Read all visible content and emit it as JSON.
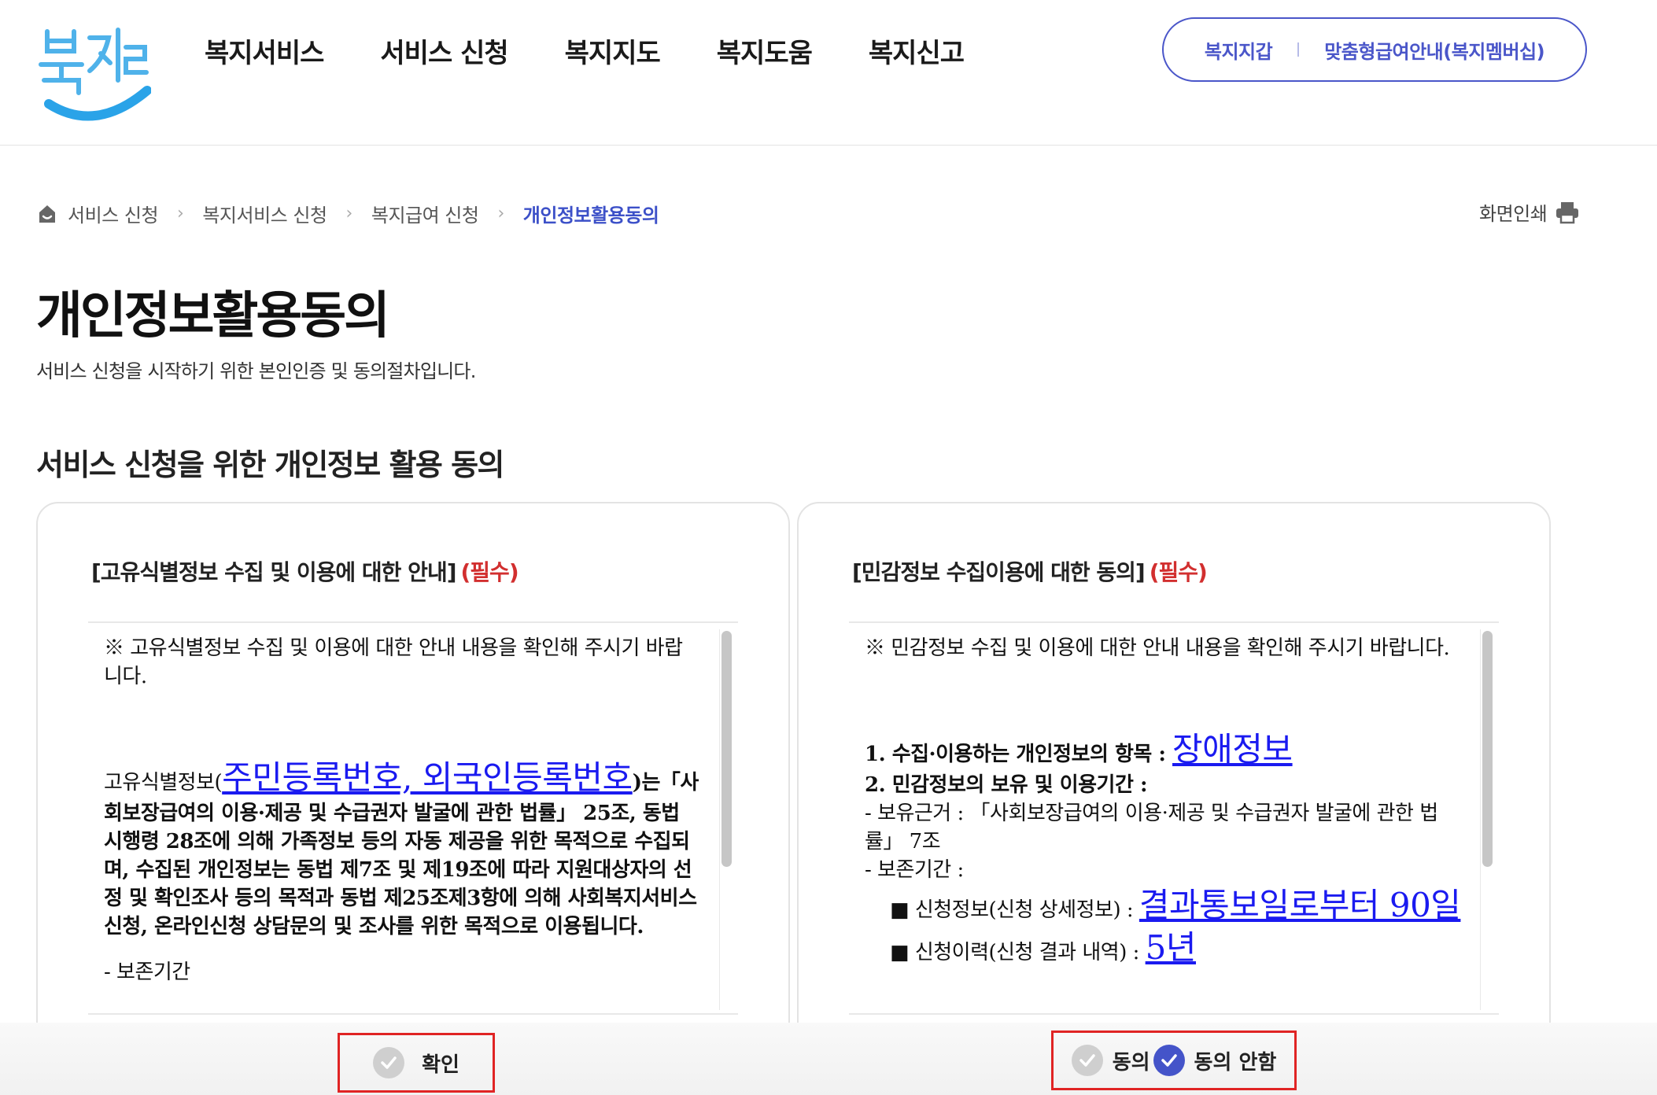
{
  "header": {
    "logo_text": "복지로",
    "nav": [
      "복지서비스",
      "서비스 신청",
      "복지지도",
      "복지도움",
      "복지신고"
    ],
    "util": [
      "복지지갑",
      "맞춤형급여안내(복지멤버십)"
    ]
  },
  "breadcrumb": {
    "items": [
      "서비스 신청",
      "복지서비스 신청",
      "복지급여 신청"
    ],
    "current": "개인정보활용동의"
  },
  "print_label": "화면인쇄",
  "page": {
    "title": "개인정보활용동의",
    "description": "서비스 신청을 시작하기 위한 본인인증 및 동의절차입니다.",
    "section_title": "서비스 신청을 위한 개인정보 활용 동의"
  },
  "cards": [
    {
      "title": "[고유식별정보 수집 및 이용에 대한 안내]",
      "required": "(필수)",
      "intro": "※ 고유식별정보 수집 및 이용에 대한 안내 내용을 확인해 주시기 바랍니다.",
      "p1_prefix": "고유식별정보(",
      "p1_highlight": "주민등록번호, 외국인등록번호",
      "p1_rest": ")는「사회보장급여의 이용·제공 및 수급권자 발굴에 관한 법률」 25조, 동법 시행령 28조에 의해 가족정보 등의 자동 제공을 위한 목적으로 수집되며, 수집된 개인정보는 동법 제7조 및 제19조에 따라 지원대상자의 선정 및 확인조사 등의 목적과 동법 제25조제3항에 의해 사회복지서비스 신청, 온라인신청 상담문의 및 조사를 위한 목적으로 이용됩니다.",
      "p2": "- 보존기간",
      "button": "확인"
    },
    {
      "title": "[민감정보 수집이용에 대한 동의]",
      "required": "(필수)",
      "intro": "※ 민감정보 수집 및 이용에 대한 안내 내용을 확인해 주시기 바랍니다.",
      "item1_label": "1. 수집·이용하는 개인정보의 항목 : ",
      "item1_value": "장애정보",
      "item2_label": "2. 민감정보의 보유 및 이용기간 :",
      "basis": " - 보유근거 : 「사회보장급여의 이용·제공 및 수급권자 발굴에 관한 법률」 7조",
      "period": " - 보존기간 :",
      "detail_label": "■ 신청정보(신청 상세정보) : ",
      "detail_value": "결과통보일로부터 90일",
      "history_label": "■ 신청이력(신청 결과 내역) : ",
      "history_value": "5년",
      "agree": "동의",
      "disagree": "동의 안함"
    }
  ],
  "colors": {
    "brand": "#4a56c9",
    "required": "#d22f2f",
    "highlight": "#1a1af0",
    "annotation": "#e02424"
  }
}
